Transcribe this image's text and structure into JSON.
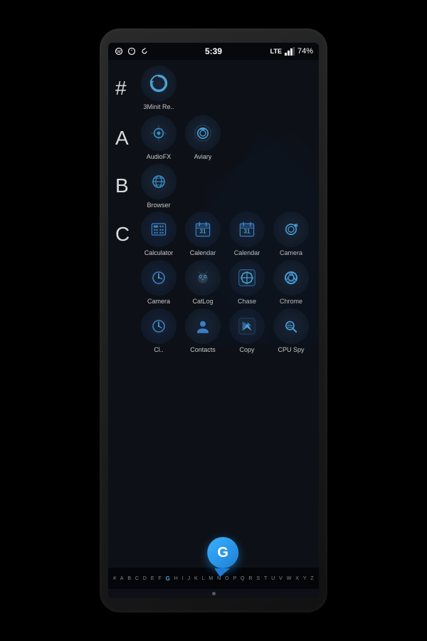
{
  "device": {
    "status_bar": {
      "time": "5:39",
      "battery": "74%",
      "signal": "LTE"
    },
    "sections": {
      "hash": {
        "letter": "#",
        "apps": [
          {
            "id": "3minit",
            "label": "3Minit Re..",
            "icon_type": "3minit"
          }
        ]
      },
      "a": {
        "letter": "A",
        "apps": [
          {
            "id": "audiofx",
            "label": "AudioFX",
            "icon_type": "audiofx"
          },
          {
            "id": "aviary",
            "label": "Aviary",
            "icon_type": "aviary"
          }
        ]
      },
      "b": {
        "letter": "B",
        "apps": [
          {
            "id": "browser",
            "label": "Browser",
            "icon_type": "browser"
          }
        ]
      },
      "c": {
        "letter": "C",
        "apps": [
          {
            "id": "calculator",
            "label": "Calculator",
            "icon_type": "calculator"
          },
          {
            "id": "calendar1",
            "label": "Calendar",
            "icon_type": "calendar1"
          },
          {
            "id": "calendar2",
            "label": "Calendar",
            "icon_type": "calendar2"
          },
          {
            "id": "camera1",
            "label": "Camera",
            "icon_type": "camera1"
          }
        ]
      },
      "c2": {
        "letter": "",
        "apps": [
          {
            "id": "camera2",
            "label": "Camera",
            "icon_type": "camera2"
          },
          {
            "id": "catlog",
            "label": "CatLog",
            "icon_type": "catlog"
          },
          {
            "id": "chase",
            "label": "Chase",
            "icon_type": "chase"
          },
          {
            "id": "chrome",
            "label": "Chrome",
            "icon_type": "chrome"
          }
        ]
      },
      "c3": {
        "letter": "",
        "apps": [
          {
            "id": "clock",
            "label": "Cl..",
            "icon_type": "clock"
          },
          {
            "id": "contacts",
            "label": "Contacts",
            "icon_type": "contacts"
          },
          {
            "id": "copy",
            "label": "Copy",
            "icon_type": "copy"
          },
          {
            "id": "cpuspy",
            "label": "CPU Spy",
            "icon_type": "cpuspy"
          }
        ]
      }
    },
    "alphabet": [
      "#",
      "A",
      "B",
      "C",
      "D",
      "E",
      "F",
      "G",
      "H",
      "I",
      "J",
      "K",
      "L",
      "M",
      "N",
      "O",
      "P",
      "Q",
      "R",
      "S",
      "T",
      "U",
      "V",
      "W",
      "X",
      "Y",
      "Z"
    ],
    "scroll_bubble": {
      "letter": "G"
    }
  }
}
